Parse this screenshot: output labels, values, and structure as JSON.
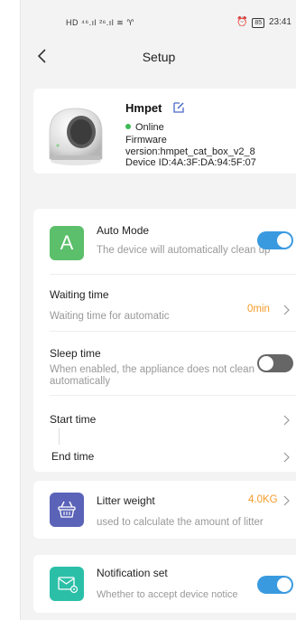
{
  "status_bar": {
    "left": "HD ⁴⁶.ıl ²⁶.ıl ≋ ♈",
    "alarm": "⏰",
    "battery": "85",
    "time": "23:41"
  },
  "nav": {
    "title": "Setup"
  },
  "device": {
    "name": "Hmpet",
    "status": "Online",
    "firmware": "Firmware\nversion:hmpet_cat_box_v2_8\nDevice ID:4A:3F:DA:94:5F:07"
  },
  "auto_mode": {
    "icon_letter": "A",
    "title": "Auto Mode",
    "subtitle": "The device will automatically clean up",
    "enabled": true
  },
  "waiting_time": {
    "title": "Waiting time",
    "subtitle": "Waiting time for automatic",
    "value": "0min"
  },
  "sleep_time": {
    "title": "Sleep time",
    "subtitle": "When enabled, the appliance does not clean automatically",
    "enabled": false
  },
  "start_time": {
    "title": "Start time"
  },
  "end_time": {
    "title": "End time"
  },
  "litter_weight": {
    "title": "Litter weight",
    "subtitle": "used to calculate the amount of litter",
    "value": "4.0KG"
  },
  "notification": {
    "title": "Notification set",
    "subtitle": "Whether to accept device notice",
    "enabled": true
  },
  "colors": {
    "accent": "#3a9ae0",
    "value_orange": "#f39c2a",
    "online_green": "#3cba54"
  }
}
